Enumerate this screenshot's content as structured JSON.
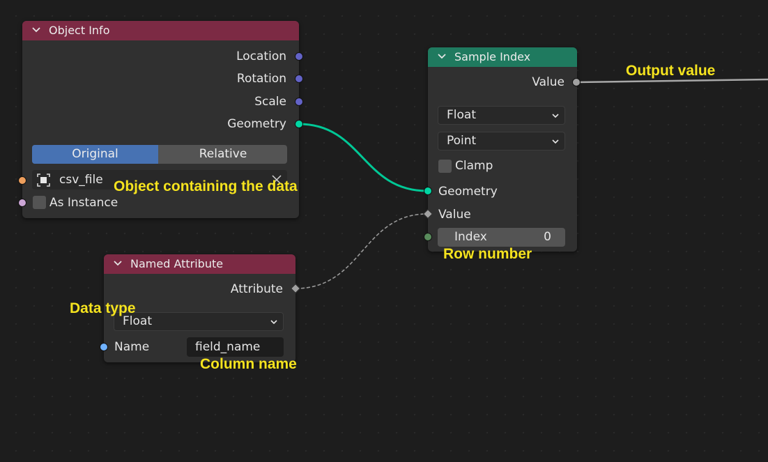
{
  "colors": {
    "object_info_header": "#7c2a44",
    "sample_index_header": "#1f7a5f",
    "named_attribute_header": "#7c2a44",
    "geometry_socket": "#00d6a3",
    "vector_socket": "#6363c7",
    "float_socket": "#a1a1a1",
    "int_socket": "#598c5c",
    "object_socket": "#ed9e5c",
    "bool_socket": "#cca6d6",
    "string_socket": "#70b2ff",
    "toggle_active": "#4772b3",
    "annotation": "#f5e31e"
  },
  "object_info": {
    "title": "Object Info",
    "outputs": [
      "Location",
      "Rotation",
      "Scale",
      "Geometry"
    ],
    "mode_options": [
      "Original",
      "Relative"
    ],
    "mode_selected": "Original",
    "object_value": "csv_file",
    "as_instance_label": "As Instance",
    "as_instance_checked": false
  },
  "sample_index": {
    "title": "Sample Index",
    "output_label": "Value",
    "data_type": "Float",
    "domain": "Point",
    "clamp_label": "Clamp",
    "clamp_checked": false,
    "inputs": {
      "geometry": "Geometry",
      "value": "Value",
      "index_label": "Index",
      "index_value": "0"
    }
  },
  "named_attribute": {
    "title": "Named Attribute",
    "output_label": "Attribute",
    "data_type": "Float",
    "name_label": "Name",
    "name_value": "field_name"
  },
  "annotations": {
    "output_value": "Output value",
    "object_containing": "Object containing the data",
    "row_number": "Row number",
    "data_type": "Data type",
    "column_name": "Column name"
  }
}
